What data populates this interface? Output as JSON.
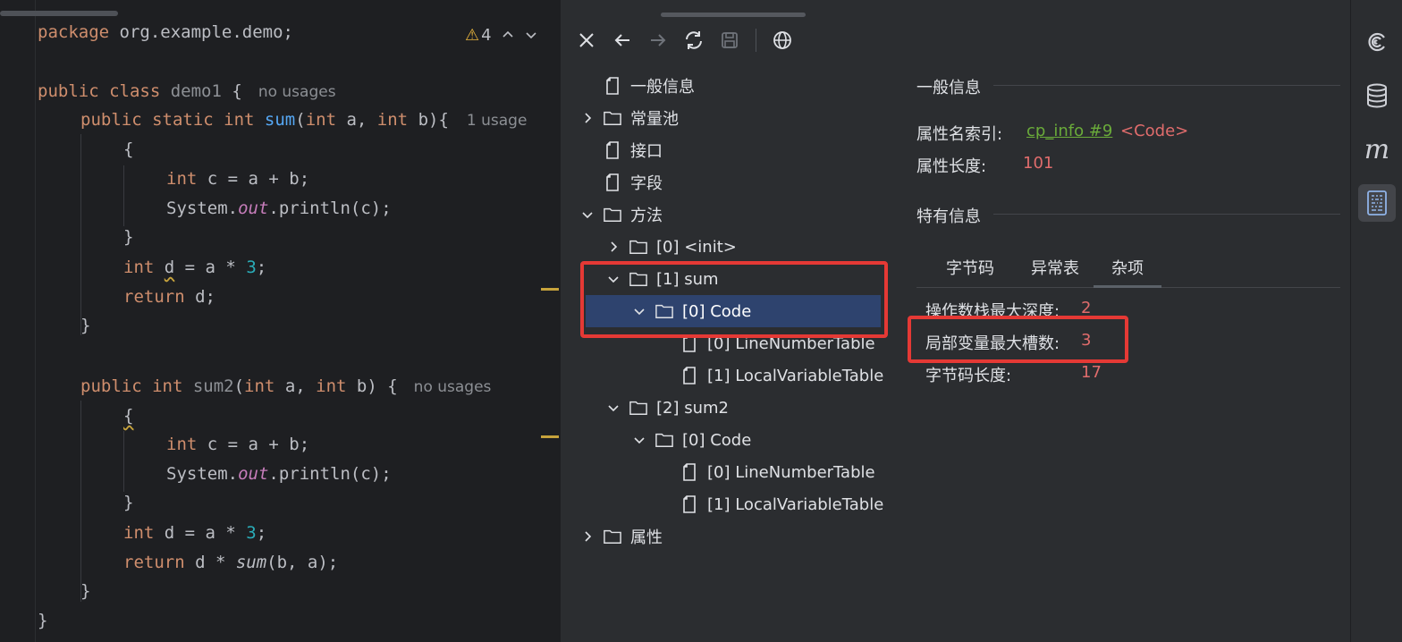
{
  "editor": {
    "inspection": {
      "warning_count": "4"
    },
    "lines": {
      "l1_a": "package",
      "l1_b": " org.example.demo;",
      "l3_a": "public class",
      "l3_b": " demo1",
      "l3_c": " {",
      "l3_hint": "no usages",
      "l4_a": "public static int",
      "l4_fn": "sum",
      "l4_b": "(",
      "l4_c": "int",
      "l4_d": " a, ",
      "l4_e": "int",
      "l4_f": " b){",
      "l4_hint": "1 usage",
      "l5": "{",
      "l6_a": "int",
      "l6_b": " c = a + b;",
      "l7_a": "System.",
      "l7_b": "out",
      "l7_c": ".println(c);",
      "l8": "}",
      "l9_a": "int",
      "l9_b": "d",
      "l9_c": " = a * ",
      "l9_d": "3",
      "l9_e": ";",
      "l10_a": "return",
      "l10_b": " d;",
      "l11": "}",
      "l13_a": "public int",
      "l13_fn": " sum2",
      "l13_b": "(",
      "l13_c": "int",
      "l13_d": " a, ",
      "l13_e": "int",
      "l13_f": " b) {",
      "l13_hint": "no usages",
      "l14": "{",
      "l15_a": "int",
      "l15_b": " c = a + b;",
      "l16_a": "System.",
      "l16_b": "out",
      "l16_c": ".println(c);",
      "l17": "}",
      "l18_a": "int",
      "l18_b": " d = a * ",
      "l18_c": "3",
      "l18_d": ";",
      "l19_a": "return",
      "l19_b": " d * ",
      "l19_c": "sum",
      "l19_d": "(b, a);",
      "l20": "}",
      "l21": "}"
    }
  },
  "viewer": {
    "tree": {
      "general": "一般信息",
      "constant_pool": "常量池",
      "interfaces": "接口",
      "fields": "字段",
      "methods": "方法",
      "m0_init": "[0] <init>",
      "m1_sum": "[1] sum",
      "m1_code": "[0] Code",
      "m1_lnt": "[0] LineNumberTable",
      "m1_lvt": "[1] LocalVariableTable",
      "m2_sum2": "[2] sum2",
      "m2_code": "[0] Code",
      "m2_lnt": "[0] LineNumberTable",
      "m2_lvt": "[1] LocalVariableTable",
      "attributes": "属性"
    },
    "detail": {
      "general_title": "一般信息",
      "attr_name_index_label": "属性名索引:",
      "attr_name_index_link": "cp_info #9",
      "attr_name_index_value": "<Code>",
      "attr_length_label": "属性长度:",
      "attr_length_value": "101",
      "specific_title": "特有信息",
      "tabs": {
        "bytecode": "字节码",
        "exception_table": "异常表",
        "misc": "杂项"
      },
      "max_stack_label": "操作数栈最大深度:",
      "max_stack_value": "2",
      "max_locals_label": "局部变量最大槽数:",
      "max_locals_value": "3",
      "code_length_label": "字节码长度:",
      "code_length_value": "17"
    }
  },
  "colors": {
    "annotation_box": "#e53935",
    "selection": "#2e436e",
    "link_green": "#6aab3a",
    "value_red": "#e06c6c"
  },
  "icons": {
    "toolbar": [
      "close-icon",
      "back-arrow-icon",
      "forward-arrow-icon",
      "refresh-icon",
      "save-icon",
      "globe-icon"
    ],
    "strip": [
      "swirl-icon",
      "database-icon",
      "maven-m-icon",
      "bytecode-viewer-icon"
    ]
  }
}
